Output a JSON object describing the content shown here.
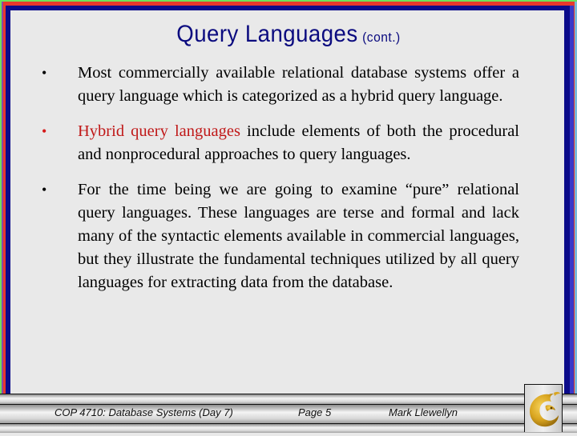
{
  "slide": {
    "title": "Query Languages",
    "title_suffix": "(cont.)",
    "bullet_glyph": "•",
    "bullets": [
      {
        "text": "Most commercially available relational database systems offer a query language which is categorized as a hybrid query language.",
        "bullet_color": "#000000"
      },
      {
        "highlight": "Hybrid query languages",
        "text": " include elements of both the procedural and nonprocedural approaches to query languages.",
        "bullet_color": "#d61a1a",
        "highlight_color": "#c01818"
      },
      {
        "text": "For the time being we are going to examine “pure” relational query languages.  These languages are terse and formal and lack many of the syntactic elements available in commercial languages, but they illustrate the fundamental techniques utilized by all query languages for extracting data from the database.",
        "bullet_color": "#000000"
      }
    ]
  },
  "footer": {
    "course": "COP 4710: Database Systems  (Day 7)",
    "page": "Page 5",
    "author": "Mark Llewellyn",
    "logo_icon": "ucf-pegasus-logo-icon"
  },
  "colors": {
    "title": "#0b0b7f",
    "background": "#e9e9e9",
    "frame_outer": "#6ee35a",
    "frame_red": "#e8392c",
    "frame_blue": "#0b0b8a"
  }
}
